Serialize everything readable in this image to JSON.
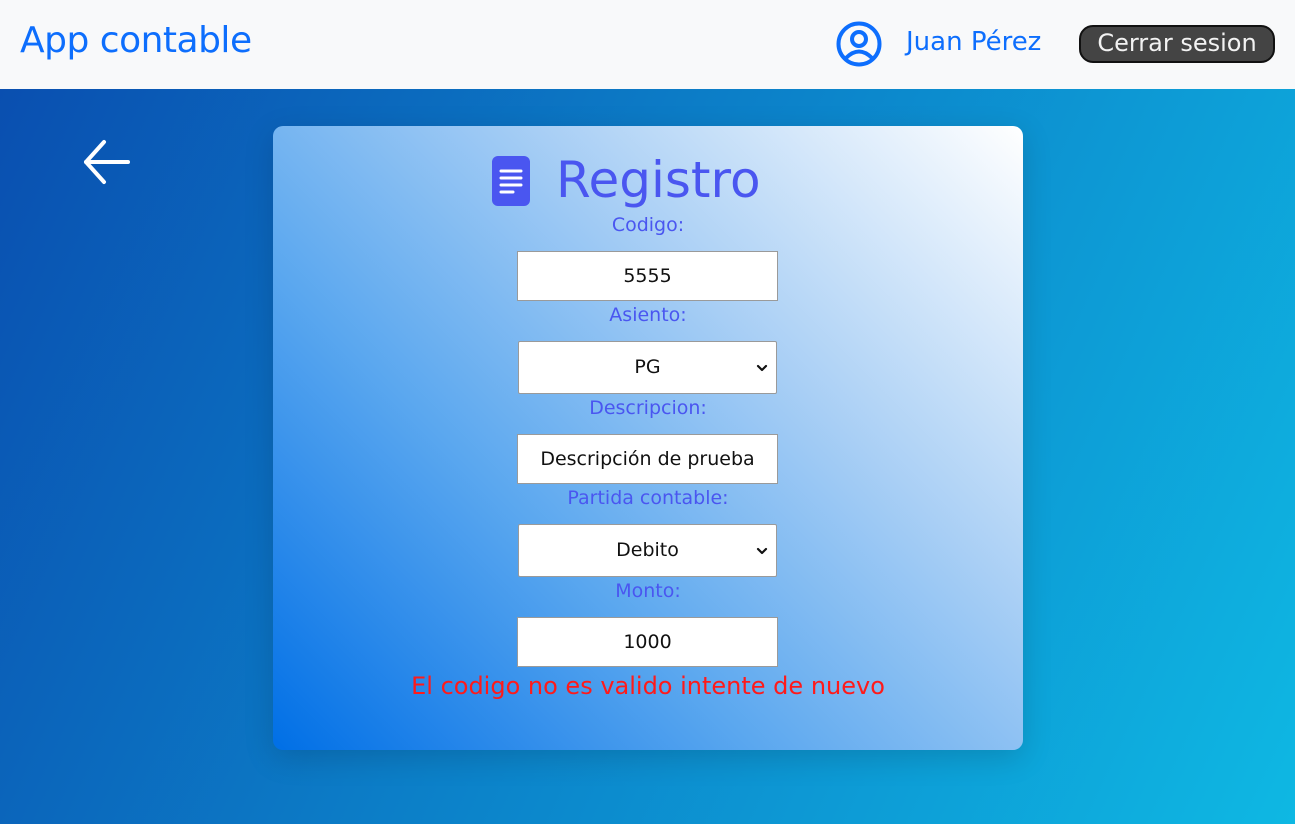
{
  "navbar": {
    "brand": "App contable",
    "user_name": "Juan Pérez",
    "logout_label": "Cerrar sesion",
    "user_icon": "user-circle-icon"
  },
  "back_icon": "arrow-left-icon",
  "form": {
    "title": "Registro",
    "title_icon": "document-icon",
    "codigo": {
      "label": "Codigo:",
      "value": "5555"
    },
    "asiento": {
      "label": "Asiento:",
      "value": "PG"
    },
    "descripcion": {
      "label": "Descripcion:",
      "value": "Descripción de prueba"
    },
    "partida": {
      "label": "Partida contable:",
      "value": "Debito"
    },
    "monto": {
      "label": "Monto:",
      "value": "1000"
    },
    "error": "El codigo no es valido intente de nuevo"
  },
  "colors": {
    "accent": "#0d6efd",
    "label": "#4a56f0",
    "error": "#ff1a1a",
    "logout_bg": "#444444"
  }
}
